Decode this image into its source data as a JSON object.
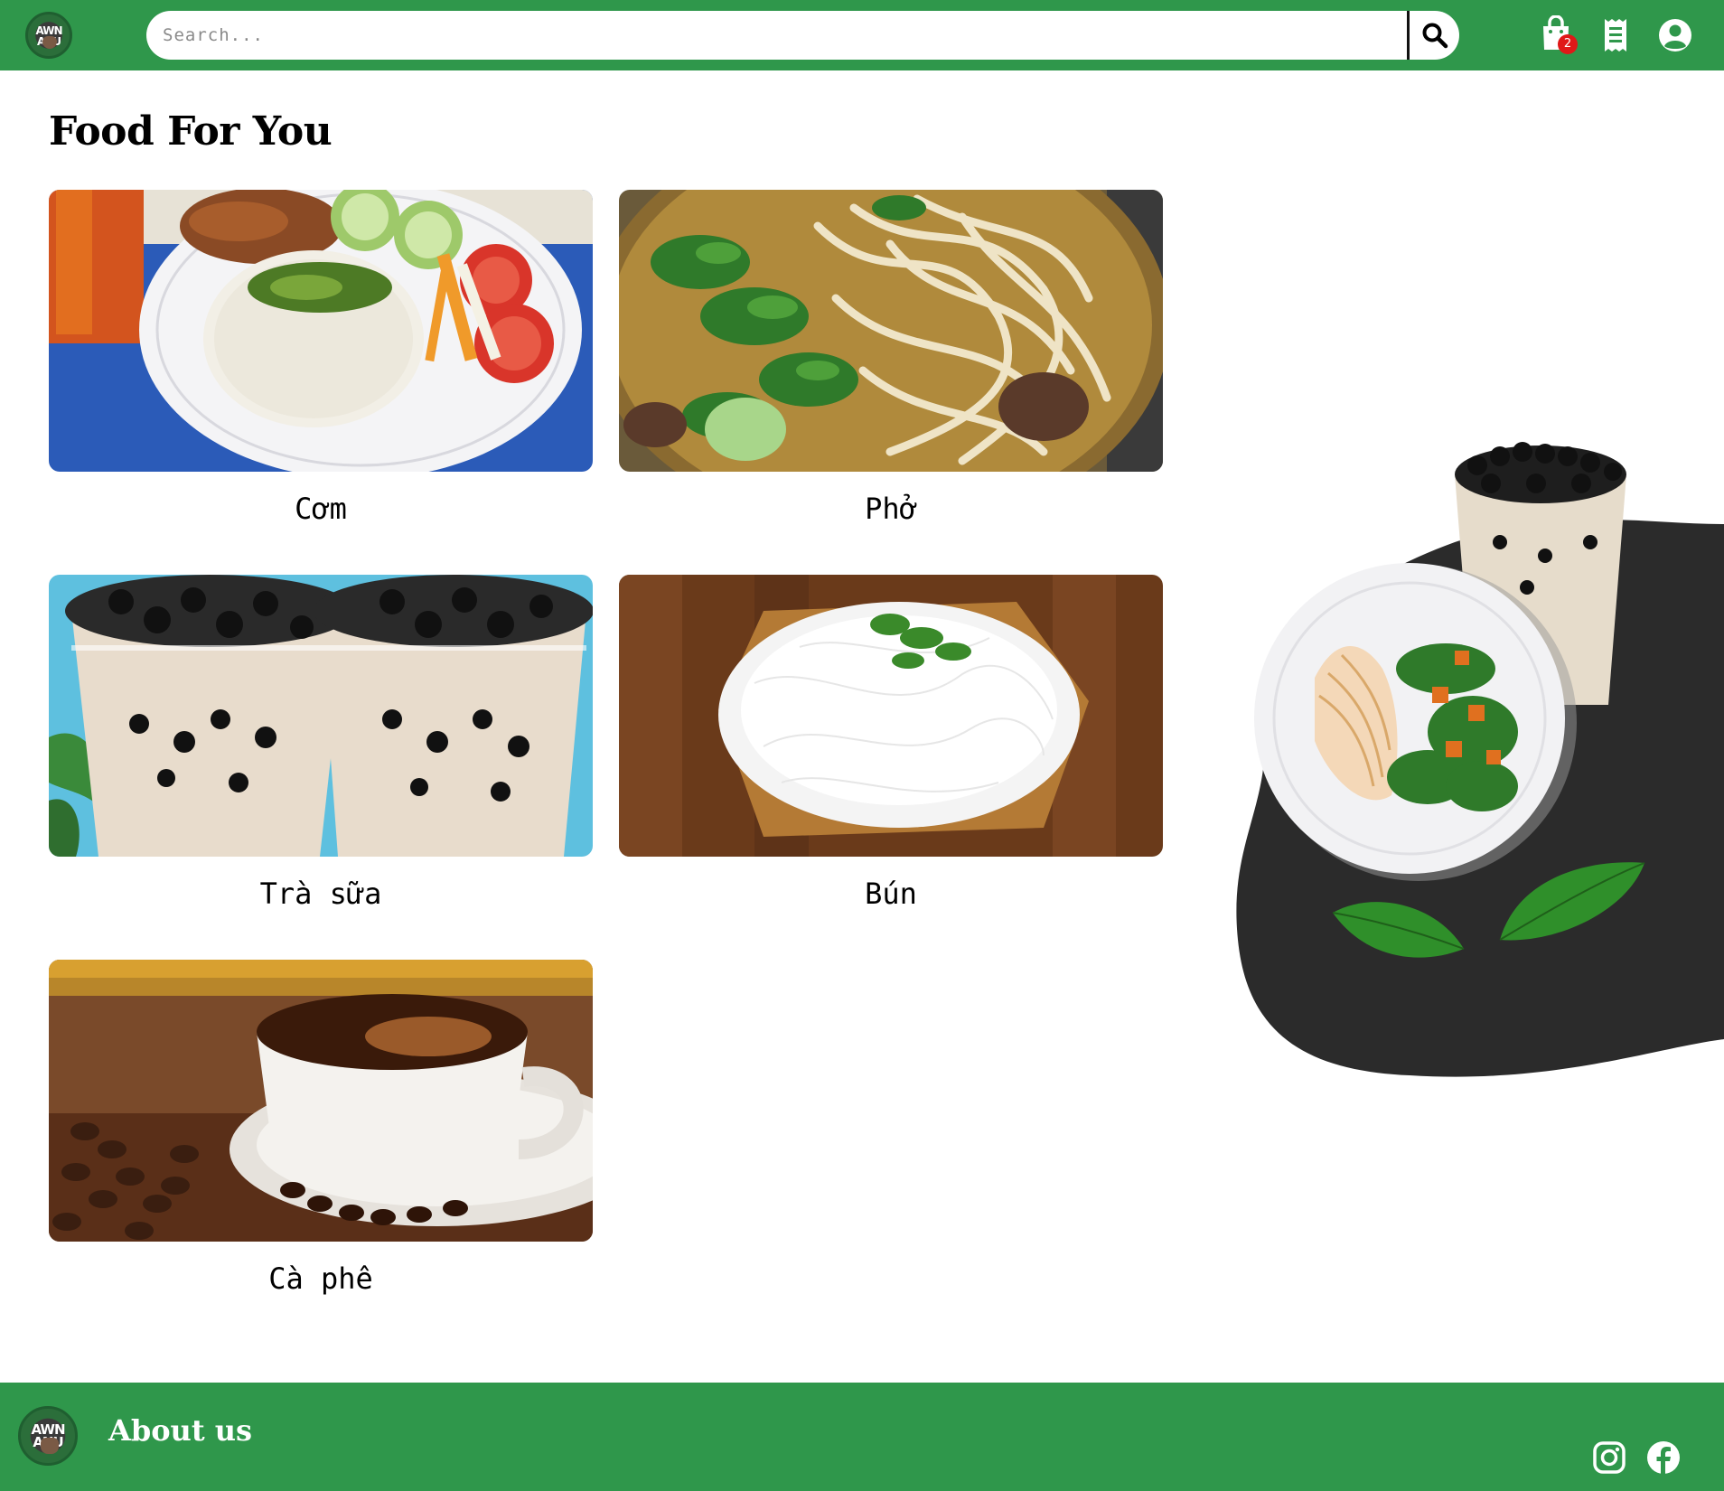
{
  "header": {
    "search_placeholder": "Search...",
    "cart_count": "2",
    "logo_text": "AWN ANU"
  },
  "main": {
    "title": "Food For You",
    "items": [
      {
        "label": "Cơm",
        "image": "com-rice-plate"
      },
      {
        "label": "Phở",
        "image": "pho-noodle-soup"
      },
      {
        "label": "Trà  sữa",
        "image": "milk-tea-cups"
      },
      {
        "label": "Bún",
        "image": "bun-rice-vermicelli"
      },
      {
        "label": "Cà  phê",
        "image": "coffee-cup"
      }
    ]
  },
  "footer": {
    "title": "About us",
    "icons": [
      "instagram-icon",
      "facebook-icon"
    ]
  },
  "colors": {
    "brand_green": "#2f974b",
    "badge_red": "#e01818",
    "hero_dark": "#2b2b2b"
  }
}
